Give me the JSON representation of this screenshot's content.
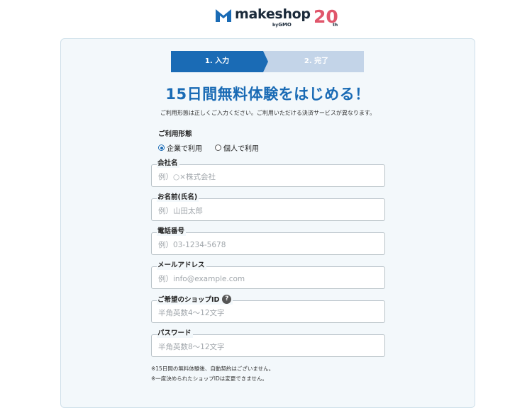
{
  "brand": {
    "name": "makeshop",
    "by": "by",
    "gmo": "GMO",
    "anniversary": "20",
    "anniversary_suffix": "th",
    "accent": "#1a6bb5",
    "step_inactive": "#c3d4e8",
    "anniversary_color": "#e0566b"
  },
  "steps": [
    {
      "label": "1. 入力",
      "active": true
    },
    {
      "label": "2. 完了",
      "active": false
    }
  ],
  "title": "15日間無料体験をはじめる！",
  "subtitle": "ご利用形態は正しくご入力ください。ご利用いただける決済サービスが異なります。",
  "usage": {
    "label": "ご利用形態",
    "options": [
      {
        "label": "企業で利用",
        "selected": true
      },
      {
        "label": "個人で利用",
        "selected": false
      }
    ]
  },
  "fields": [
    {
      "label": "会社名",
      "placeholder": "例）○×株式会社",
      "value": ""
    },
    {
      "label": "お名前(氏名)",
      "placeholder": "例）山田太郎",
      "value": ""
    },
    {
      "label": "電話番号",
      "placeholder": "例）03-1234-5678",
      "value": ""
    },
    {
      "label": "メールアドレス",
      "placeholder": "例）info@example.com",
      "value": ""
    },
    {
      "label": "ご希望のショップID",
      "placeholder": "半角英数4〜12文字",
      "value": "",
      "help": "?"
    },
    {
      "label": "パスワード",
      "placeholder": "半角英数8〜12文字",
      "value": ""
    }
  ],
  "notes": [
    "※15日間の無料体験後、自動契約はございません。",
    "※一度決められたショップIDは変更できません。"
  ]
}
